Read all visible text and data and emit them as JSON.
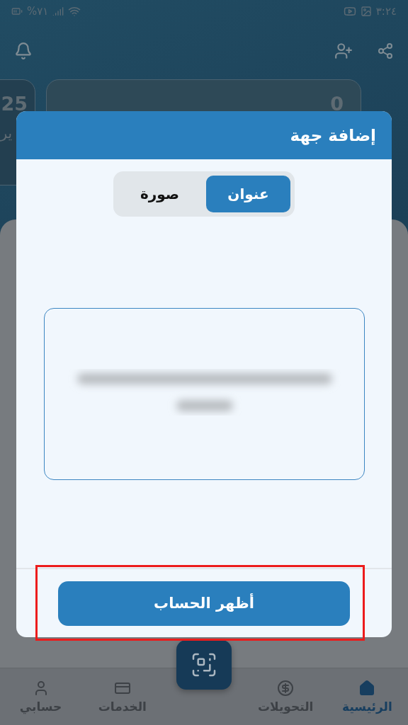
{
  "status_bar": {
    "time": "٣:٢٤",
    "battery": "%٧١"
  },
  "cards": [
    {
      "value": "0"
    },
    {
      "value": "25",
      "caption": "ير"
    }
  ],
  "dialog": {
    "title": "إضافة جهة",
    "tabs": [
      {
        "label": "عنوان",
        "selected": true
      },
      {
        "label": "صورة",
        "selected": false
      }
    ],
    "button": "أظهر الحساب",
    "highlighted": true
  },
  "nav": {
    "items": [
      {
        "label": "الرئيسية",
        "kind": "home",
        "selected": true
      },
      {
        "label": "التحويلات",
        "kind": "transfers",
        "selected": false
      },
      {
        "label": "الخدمات",
        "kind": "services",
        "selected": false
      },
      {
        "label": "حسابي",
        "kind": "account",
        "selected": false
      }
    ]
  }
}
